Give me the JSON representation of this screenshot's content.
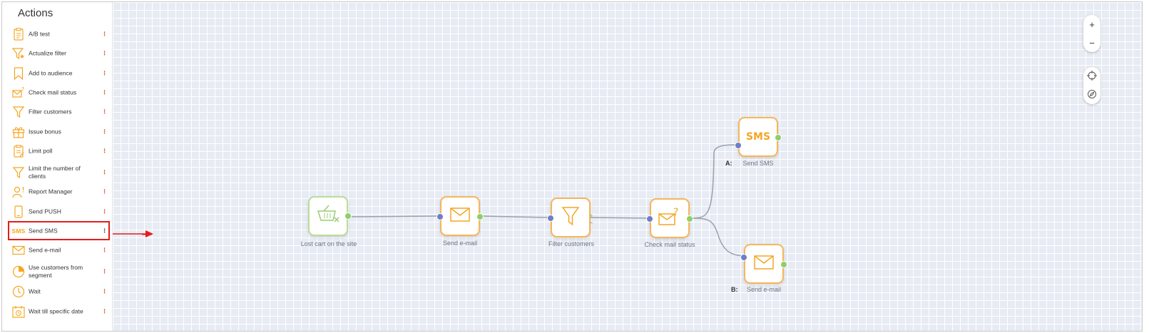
{
  "sidebar": {
    "title": "Actions",
    "items": [
      {
        "label": "A/B test",
        "icon": "ab-test-icon"
      },
      {
        "label": "Actualize filter",
        "icon": "filter-star-icon"
      },
      {
        "label": "Add to audience",
        "icon": "bookmark-icon"
      },
      {
        "label": "Check mail status",
        "icon": "mail-question-icon"
      },
      {
        "label": "Filter customers",
        "icon": "filter-icon"
      },
      {
        "label": "Issue bonus",
        "icon": "gift-icon"
      },
      {
        "label": "Limit poll",
        "icon": "clipboard-icon"
      },
      {
        "label": "Limit the number of clients",
        "icon": "filter-icon"
      },
      {
        "label": "Report Manager",
        "icon": "user-alert-icon"
      },
      {
        "label": "Send PUSH",
        "icon": "phone-icon"
      },
      {
        "label": "Send SMS",
        "icon": "sms-icon",
        "icon_text": "SMS"
      },
      {
        "label": "Send e-mail",
        "icon": "mail-icon"
      },
      {
        "label": "Use customers from segment",
        "icon": "pie-icon"
      },
      {
        "label": "Wait",
        "icon": "clock-icon"
      },
      {
        "label": "Wait till specific date",
        "icon": "calendar-clock-icon"
      }
    ],
    "menu_glyph": "⁝"
  },
  "canvas": {
    "nodes": [
      {
        "label": "Lost cart on the site",
        "icon": "cart-icon"
      },
      {
        "label": "Send e-mail",
        "icon": "mail-icon"
      },
      {
        "label": "Filter customers",
        "icon": "filter-icon",
        "plus": "+",
        "minus": "−"
      },
      {
        "label": "Check mail status",
        "icon": "mail-question-icon"
      },
      {
        "label": "Send SMS",
        "icon": "sms-icon",
        "icon_text": "SMS",
        "branch": "A:"
      },
      {
        "label": "Send e-mail",
        "icon": "mail-icon",
        "branch": "B:"
      }
    ]
  },
  "zoom": {
    "in": "+",
    "out": "−"
  },
  "colors": {
    "accent": "#f5a623",
    "selected_border": "#e51c1c",
    "grid_bg": "#e7ebf3",
    "port_in": "#6e7ec9",
    "port_out": "#8fcf6a"
  }
}
